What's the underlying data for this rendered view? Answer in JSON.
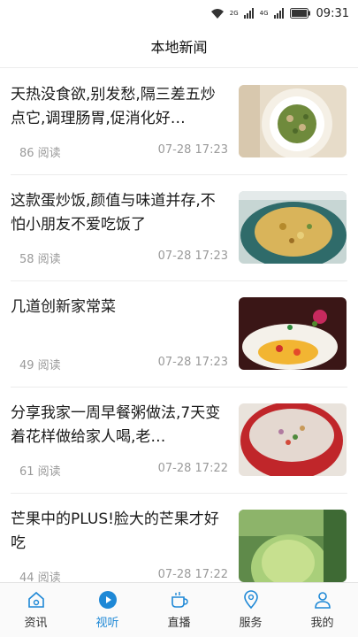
{
  "status": {
    "time": "09:31",
    "net1": "2G",
    "net2": "4G"
  },
  "header": {
    "title": "本地新闻"
  },
  "feed": {
    "items": [
      {
        "title": "天热没食欲,别发愁,隔三差五炒点它,调理肠胃,促消化好…",
        "reads": "86 阅读",
        "time": "07-28 17:23"
      },
      {
        "title": "这款蛋炒饭,颜值与味道并存,不怕小朋友不爱吃饭了",
        "reads": "58 阅读",
        "time": "07-28 17:23"
      },
      {
        "title": "几道创新家常菜",
        "reads": "49 阅读",
        "time": "07-28 17:23"
      },
      {
        "title": "分享我家一周早餐粥做法,7天变着花样做给家人喝,老…",
        "reads": "61 阅读",
        "time": "07-28 17:22"
      },
      {
        "title": "芒果中的PLUS!脸大的芒果才好吃",
        "reads": "44 阅读",
        "time": "07-28 17:22"
      }
    ]
  },
  "tabbar": {
    "tabs": [
      {
        "label": "资讯",
        "icon": "home-icon"
      },
      {
        "label": "视听",
        "icon": "play-icon"
      },
      {
        "label": "直播",
        "icon": "cup-icon"
      },
      {
        "label": "服务",
        "icon": "location-icon"
      },
      {
        "label": "我的",
        "icon": "profile-icon"
      }
    ],
    "active_color": "#1e88d6"
  }
}
